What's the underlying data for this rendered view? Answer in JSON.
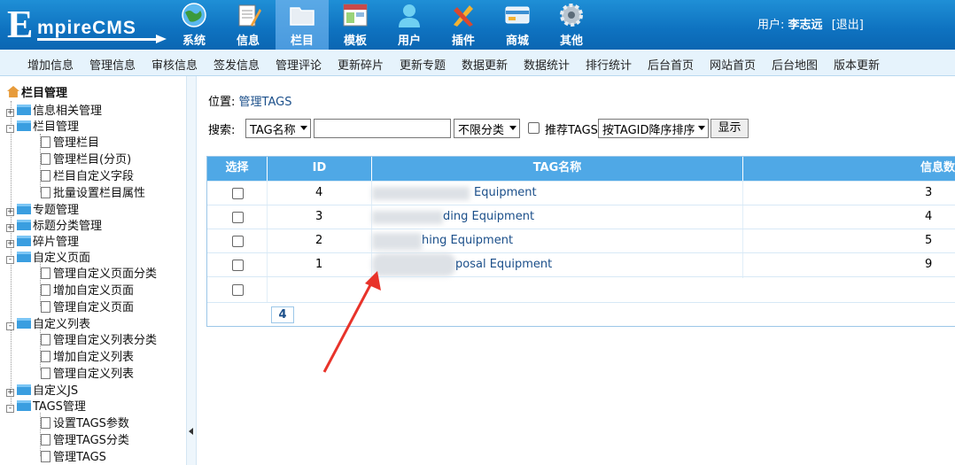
{
  "app": {
    "logo_initial": "E",
    "logo_rest": "mpireCMS"
  },
  "nav": [
    {
      "label": "系统",
      "icon": "globe-icon"
    },
    {
      "label": "信息",
      "icon": "notepad-icon"
    },
    {
      "label": "栏目",
      "icon": "folder-icon"
    },
    {
      "label": "模板",
      "icon": "window-icon"
    },
    {
      "label": "用户",
      "icon": "user-icon"
    },
    {
      "label": "插件",
      "icon": "tools-icon"
    },
    {
      "label": "商城",
      "icon": "card-icon"
    },
    {
      "label": "其他",
      "icon": "gear-icon"
    }
  ],
  "user": {
    "prefix": "用户:",
    "name": "李志远",
    "logout": "[退出]"
  },
  "submenu": [
    "增加信息",
    "管理信息",
    "审核信息",
    "签发信息",
    "管理评论",
    "更新碎片",
    "更新专题",
    "数据更新",
    "数据统计",
    "排行统计",
    "后台首页",
    "网站首页",
    "后台地图",
    "版本更新"
  ],
  "tree": {
    "root": "栏目管理",
    "items": [
      {
        "label": "信息相关管理",
        "type": "folder",
        "state": "+"
      },
      {
        "label": "栏目管理",
        "type": "folder-open",
        "state": "-"
      },
      {
        "label": "管理栏目",
        "type": "doc"
      },
      {
        "label": "管理栏目(分页)",
        "type": "doc"
      },
      {
        "label": "栏目自定义字段",
        "type": "doc"
      },
      {
        "label": "批量设置栏目属性",
        "type": "doc"
      },
      {
        "label": "专题管理",
        "type": "folder",
        "state": "+"
      },
      {
        "label": "标题分类管理",
        "type": "folder",
        "state": "+"
      },
      {
        "label": "碎片管理",
        "type": "folder",
        "state": "+"
      },
      {
        "label": "自定义页面",
        "type": "folder-open",
        "state": "-"
      },
      {
        "label": "管理自定义页面分类",
        "type": "doc"
      },
      {
        "label": "增加自定义页面",
        "type": "doc"
      },
      {
        "label": "管理自定义页面",
        "type": "doc"
      },
      {
        "label": "自定义列表",
        "type": "folder-open",
        "state": "-"
      },
      {
        "label": "管理自定义列表分类",
        "type": "doc"
      },
      {
        "label": "增加自定义列表",
        "type": "doc"
      },
      {
        "label": "管理自定义列表",
        "type": "doc"
      },
      {
        "label": "自定义JS",
        "type": "folder",
        "state": "+"
      },
      {
        "label": "TAGS管理",
        "type": "folder-open",
        "state": "-"
      },
      {
        "label": "设置TAGS参数",
        "type": "doc"
      },
      {
        "label": "管理TAGS分类",
        "type": "doc"
      },
      {
        "label": "管理TAGS",
        "type": "doc"
      }
    ]
  },
  "main": {
    "crumb_prefix": "位置:",
    "crumb_link": "管理TAGS",
    "search_label": "搜索:",
    "search_field_select": "TAG名称",
    "search_value": "",
    "category_select": "不限分类",
    "recommend_label": "推荐TAGS",
    "sort_select": "按TAGID降序排序",
    "show_button": "显示"
  },
  "table": {
    "headers": [
      "选择",
      "ID",
      "TAG名称",
      "信息数"
    ],
    "rows": [
      {
        "id": "4",
        "name": "Equipment",
        "count": "3"
      },
      {
        "id": "3",
        "name": "ding Equipment",
        "count": "4"
      },
      {
        "id": "2",
        "name": "hing Equipment",
        "count": "5"
      },
      {
        "id": "1",
        "name": "posal Equipment",
        "count": "9"
      }
    ],
    "page": "4"
  },
  "colors": {
    "header": "#0e72c0",
    "table_header": "#4fa8e6",
    "annotation_arrow": "#e8332a"
  }
}
